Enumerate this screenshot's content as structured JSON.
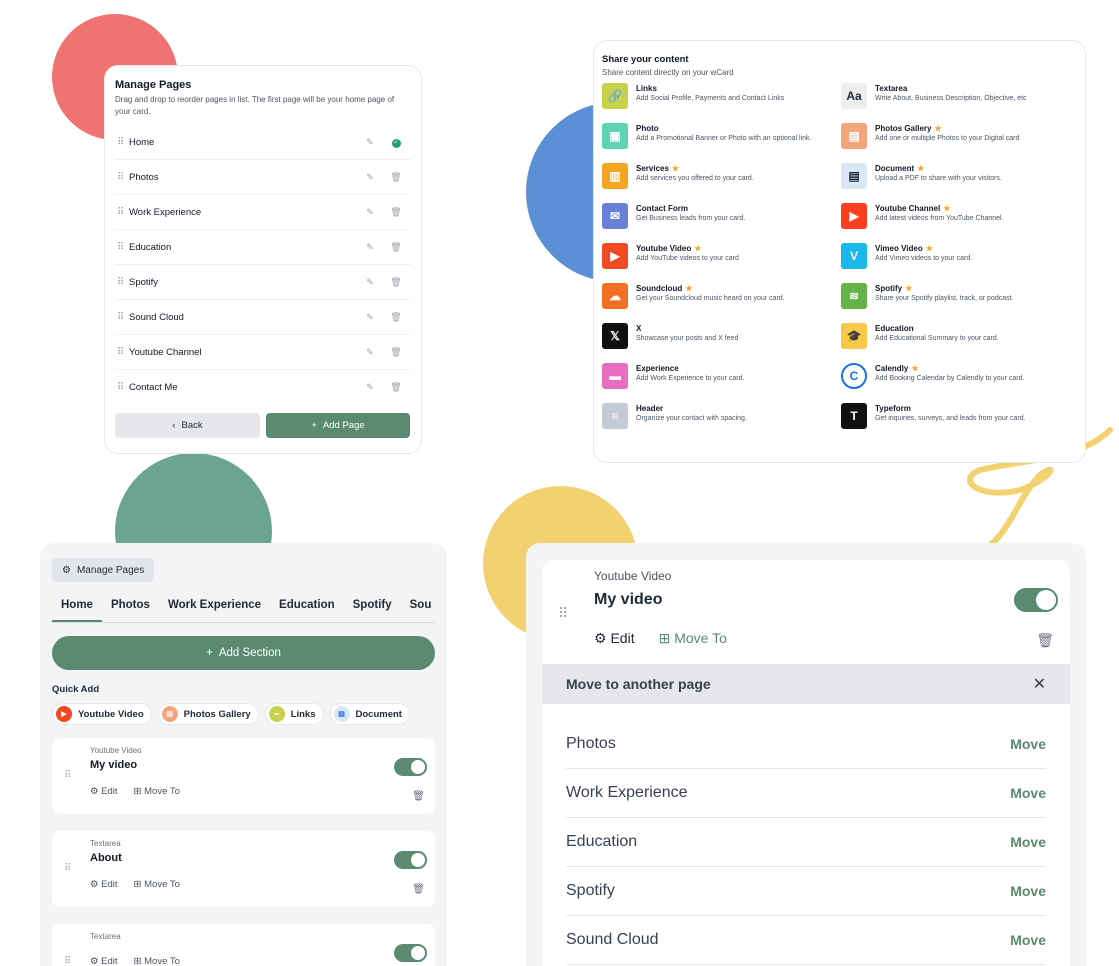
{
  "manage_pages": {
    "title": "Manage Pages",
    "subtitle": "Drag and drop to reorder pages in list. The first page will be your home page of your card.",
    "pages": [
      {
        "label": "Home"
      },
      {
        "label": "Photos"
      },
      {
        "label": "Work Experience"
      },
      {
        "label": "Education"
      },
      {
        "label": "Spotify"
      },
      {
        "label": "Sound Cloud"
      },
      {
        "label": "Youtube Channel"
      },
      {
        "label": "Contact Me"
      }
    ],
    "back_label": "Back",
    "add_page_label": "Add Page"
  },
  "share": {
    "title": "Share your content",
    "subtitle": "Share content directly on your wCard",
    "items": [
      {
        "title": "Links",
        "star": false,
        "desc": "Add Social Profile, Payments and Contact Links",
        "icon": "link-icon",
        "color": "#c7d14a",
        "glyph": "🔗"
      },
      {
        "title": "Textarea",
        "star": false,
        "desc": "Write About, Business Description, Objective, etc",
        "icon": "text-icon",
        "color": "#eeeeee",
        "glyph": "Aa"
      },
      {
        "title": "Photo",
        "star": false,
        "desc": "Add a Promotional Banner or Photo with an optional link.",
        "icon": "photo-icon",
        "color": "#5fd3b3",
        "glyph": "▣"
      },
      {
        "title": "Photos Gallery",
        "star": true,
        "desc": "Add one or multiple Photos to your Digital card",
        "icon": "gallery-icon",
        "color": "#f4a57b",
        "glyph": "▤"
      },
      {
        "title": "Services",
        "star": true,
        "desc": "Add services you offered to your card.",
        "icon": "services-icon",
        "color": "#f5a524",
        "glyph": "▥"
      },
      {
        "title": "Document",
        "star": true,
        "desc": "Upload a PDF to share with your visitors.",
        "icon": "document-icon",
        "color": "#dbe7f7",
        "glyph": "▤"
      },
      {
        "title": "Contact Form",
        "star": false,
        "desc": "Get Business leads from your card.",
        "icon": "mail-icon",
        "color": "#6a7fd6",
        "glyph": "✉"
      },
      {
        "title": "Youtube Channel",
        "star": true,
        "desc": "Add latest videos from YouTube Channel.",
        "icon": "youtube-icon",
        "color": "#ff3d1f",
        "glyph": "▶"
      },
      {
        "title": "Youtube Video",
        "star": true,
        "desc": "Add YouTube videos to your card",
        "icon": "youtube-icon",
        "color": "#f04a22",
        "glyph": "▶"
      },
      {
        "title": "Vimeo Video",
        "star": true,
        "desc": "Add Vimeo videos to your card.",
        "icon": "vimeo-icon",
        "color": "#1ab7ea",
        "glyph": "V"
      },
      {
        "title": "Soundcloud",
        "star": true,
        "desc": "Get your Soundcloud music heard on your card.",
        "icon": "soundcloud-icon",
        "color": "#f26f23",
        "glyph": "☁"
      },
      {
        "title": "Spotify",
        "star": true,
        "desc": "Share your Spotify playlist, track, or podcast.",
        "icon": "spotify-icon",
        "color": "#65b246",
        "glyph": "≋"
      },
      {
        "title": "X",
        "star": false,
        "desc": "Showcase your posts and X feed",
        "icon": "x-icon",
        "color": "#111111",
        "glyph": "𝕏"
      },
      {
        "title": "Education",
        "star": false,
        "desc": "Add Educational Summary to your card.",
        "icon": "graduation-cap-icon",
        "color": "#f7c948",
        "glyph": "🎓"
      },
      {
        "title": "Experience",
        "star": false,
        "desc": "Add Work Experience to your card.",
        "icon": "briefcase-icon",
        "color": "#e86ec0",
        "glyph": "▬"
      },
      {
        "title": "Calendly",
        "star": true,
        "desc": "Add Booking Calendar by Calendly to your card.",
        "icon": "calendly-icon",
        "color": "#ffffff",
        "glyph": "C"
      },
      {
        "title": "Header",
        "star": false,
        "desc": "Organize your contact with spacing.",
        "icon": "header-icon",
        "color": "#c5cbd6",
        "glyph": "≡"
      },
      {
        "title": "Typeform",
        "star": false,
        "desc": "Get inquiries, surveys, and leads from your card.",
        "icon": "typeform-icon",
        "color": "#111111",
        "glyph": "T"
      }
    ]
  },
  "editor": {
    "manage_pages_label": "Manage Pages",
    "tabs": [
      "Home",
      "Photos",
      "Work Experience",
      "Education",
      "Spotify",
      "Sou"
    ],
    "add_section_label": "Add Section",
    "quick_add_label": "Quick Add",
    "quick_add": [
      {
        "label": "Youtube Video",
        "color": "#f04a22",
        "glyph": "▶",
        "icon": "youtube-icon"
      },
      {
        "label": "Photos Gallery",
        "color": "#f4a57b",
        "glyph": "▤",
        "icon": "gallery-icon"
      },
      {
        "label": "Links",
        "color": "#c7d14a",
        "glyph": "∞",
        "icon": "link-icon"
      },
      {
        "label": "Document",
        "color": "#dbe7f7",
        "glyph": "▤",
        "icon": "document-icon"
      }
    ],
    "sections": [
      {
        "type": "Youtube Video",
        "name": "My video"
      },
      {
        "type": "Textarea",
        "name": "About"
      },
      {
        "type": "Textarea",
        "name": ""
      }
    ],
    "edit_label": "Edit",
    "move_to_label": "Move To"
  },
  "move_panel": {
    "type": "Youtube Video",
    "name": "My video",
    "edit_label": "Edit",
    "move_to_label": "Move To",
    "bar_title": "Move to another page",
    "move_label": "Move",
    "pages": [
      "Photos",
      "Work Experience",
      "Education",
      "Spotify",
      "Sound Cloud"
    ]
  }
}
